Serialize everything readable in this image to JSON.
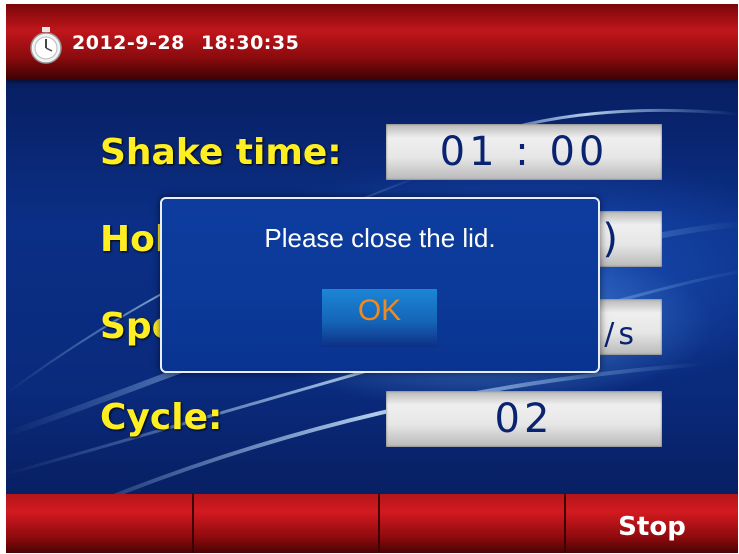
{
  "header": {
    "date": "2012-9-28",
    "time": "18:30:35",
    "clock_icon": "stopwatch-icon"
  },
  "fields": [
    {
      "label": "Shake time:",
      "value": "01 : 00"
    },
    {
      "label": "Hol",
      "value": ")"
    },
    {
      "label": "Spe",
      "value": "/s"
    },
    {
      "label": "Cycle:",
      "value": "02"
    }
  ],
  "dialog": {
    "message": "Please close the lid.",
    "ok_label": "OK"
  },
  "softkeys": [
    "",
    "",
    "",
    "Stop"
  ],
  "colors": {
    "label": "#ffee22",
    "value_text": "#0a2370",
    "ok_text": "#f08a1e",
    "bar_red": "#c0161b"
  }
}
